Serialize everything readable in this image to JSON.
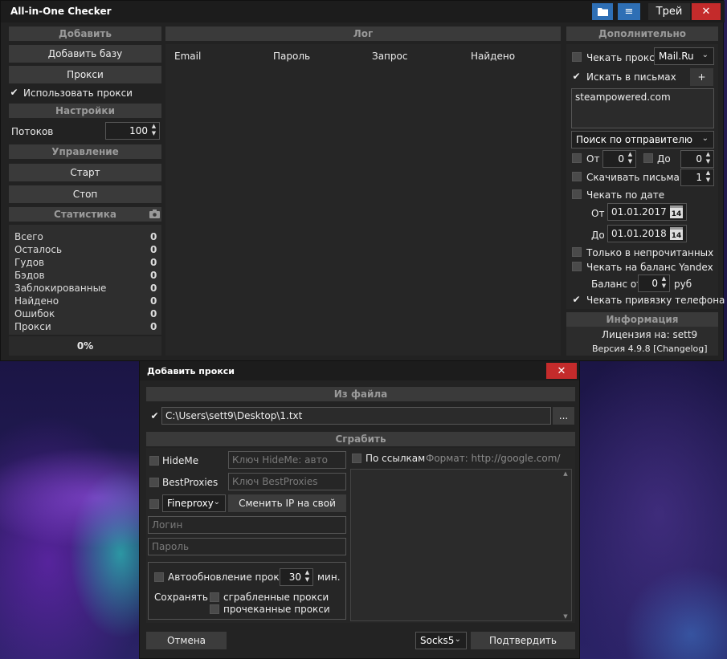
{
  "main": {
    "title": "All-in-One Checker",
    "tray_label": "Трей",
    "close_glyph": "✕",
    "menu_glyph": "≡",
    "left": {
      "add_header": "Добавить",
      "add_base": "Добавить базу",
      "proxy": "Прокси",
      "use_proxy": "Использовать прокси",
      "settings_header": "Настройки",
      "threads_label": "Потоков",
      "threads_value": "100",
      "control_header": "Управление",
      "start": "Старт",
      "stop": "Стоп",
      "stats_header": "Статистика",
      "stats": [
        {
          "label": "Всего",
          "value": "0"
        },
        {
          "label": "Осталось",
          "value": "0"
        },
        {
          "label": "Гудов",
          "value": "0"
        },
        {
          "label": "Бэдов",
          "value": "0"
        },
        {
          "label": "Заблокированные",
          "value": "0"
        },
        {
          "label": "Найдено",
          "value": "0"
        },
        {
          "label": "Ошибок",
          "value": "0"
        },
        {
          "label": "Прокси",
          "value": "0"
        }
      ],
      "progress": "0%"
    },
    "log": {
      "header": "Лог",
      "columns": [
        "Email",
        "Пароль",
        "Запрос",
        "Найдено"
      ]
    },
    "right": {
      "header": "Дополнительно",
      "check_proxy": "Чекать прокси",
      "provider": "Mail.Ru",
      "search_letters": "Искать в письмах",
      "plus": "+",
      "search_text": "steampowered.com",
      "search_mode": "Поиск по отправителю",
      "from_label": "От",
      "from_value": "0",
      "to_label": "До",
      "to_value": "0",
      "download_letters": "Скачивать письма",
      "download_value": "1",
      "check_by_date": "Чекать по дате",
      "date_from_label": "От",
      "date_from": "01.01.2017",
      "date_to_label": "До",
      "date_to": "01.01.2018",
      "calendar_day": "14",
      "only_unread": "Только в непрочитанных",
      "check_yandex": "Чекать на баланс Yandex",
      "balance_from": "Баланс от",
      "balance_value": "0",
      "currency": "руб",
      "check_phone": "Чекать привязку телефона",
      "info_header": "Информация",
      "license": "Лицензия на: sett9",
      "version": "Версия 4.9.8 [Changelog]"
    }
  },
  "dialog": {
    "title": "Добавить прокси",
    "close_glyph": "✕",
    "from_file_header": "Из файла",
    "file_path": "C:\\Users\\sett9\\Desktop\\1.txt",
    "browse": "...",
    "grab_header": "Сграбить",
    "hideme": "HideMe",
    "hideme_key_placeholder": "Ключ HideMe: авто",
    "bestproxies": "BestProxies",
    "bestproxies_key_placeholder": "Ключ BestProxies",
    "fineproxy": "Fineproxy",
    "change_ip": "Сменить IP на свой",
    "login_placeholder": "Логин",
    "password_placeholder": "Пароль",
    "by_links": "По ссылкам",
    "format_hint": "Формат: http://google.com/",
    "auto_update": "Автообновление прокси",
    "auto_update_value": "30",
    "minutes": "мин.",
    "save_label": "Сохранять",
    "grabbed": "сграбленные прокси",
    "checked": "прочеканные прокси",
    "cancel": "Отмена",
    "proxy_type": "Socks5",
    "confirm": "Подтвердить"
  }
}
